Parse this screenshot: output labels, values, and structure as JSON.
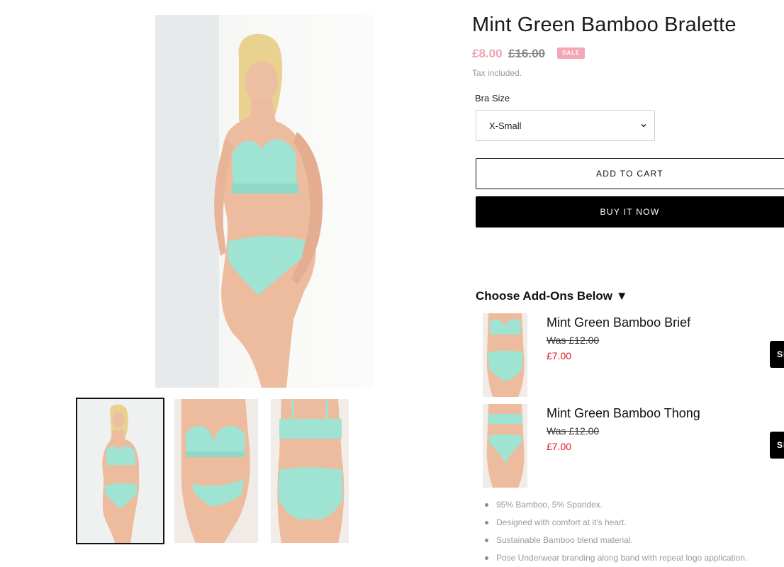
{
  "product": {
    "title": "Mint Green Bamboo Bralette",
    "sale_price": "£8.00",
    "compare_price": "£16.00",
    "sale_badge": "SALE",
    "tax_note": "Tax included."
  },
  "size_selector": {
    "label": "Bra Size",
    "selected": "X-Small"
  },
  "buttons": {
    "add_to_cart": "ADD TO CART",
    "buy_now": "BUY IT NOW"
  },
  "addons": {
    "heading": "Choose Add-Ons Below ▼",
    "items": [
      {
        "name": "Mint Green Bamboo Brief",
        "was": "Was £12.00",
        "price": "£7.00",
        "button": "SE"
      },
      {
        "name": "Mint Green Bamboo Thong",
        "was": "Was £12.00",
        "price": "£7.00",
        "button": "SE"
      }
    ]
  },
  "features": [
    "95% Bamboo, 5% Spandex.",
    "Designed with comfort at it's heart.",
    "Sustainable Bamboo blend material.",
    "Pose Underwear branding along band with repeat logo application."
  ],
  "colors": {
    "sale_price": "#f0a3b4",
    "sale_badge": "#f4a7b6",
    "addon_price": "#e4151f",
    "garment": "#9fe3d2",
    "buy_now_bg": "#000000"
  }
}
